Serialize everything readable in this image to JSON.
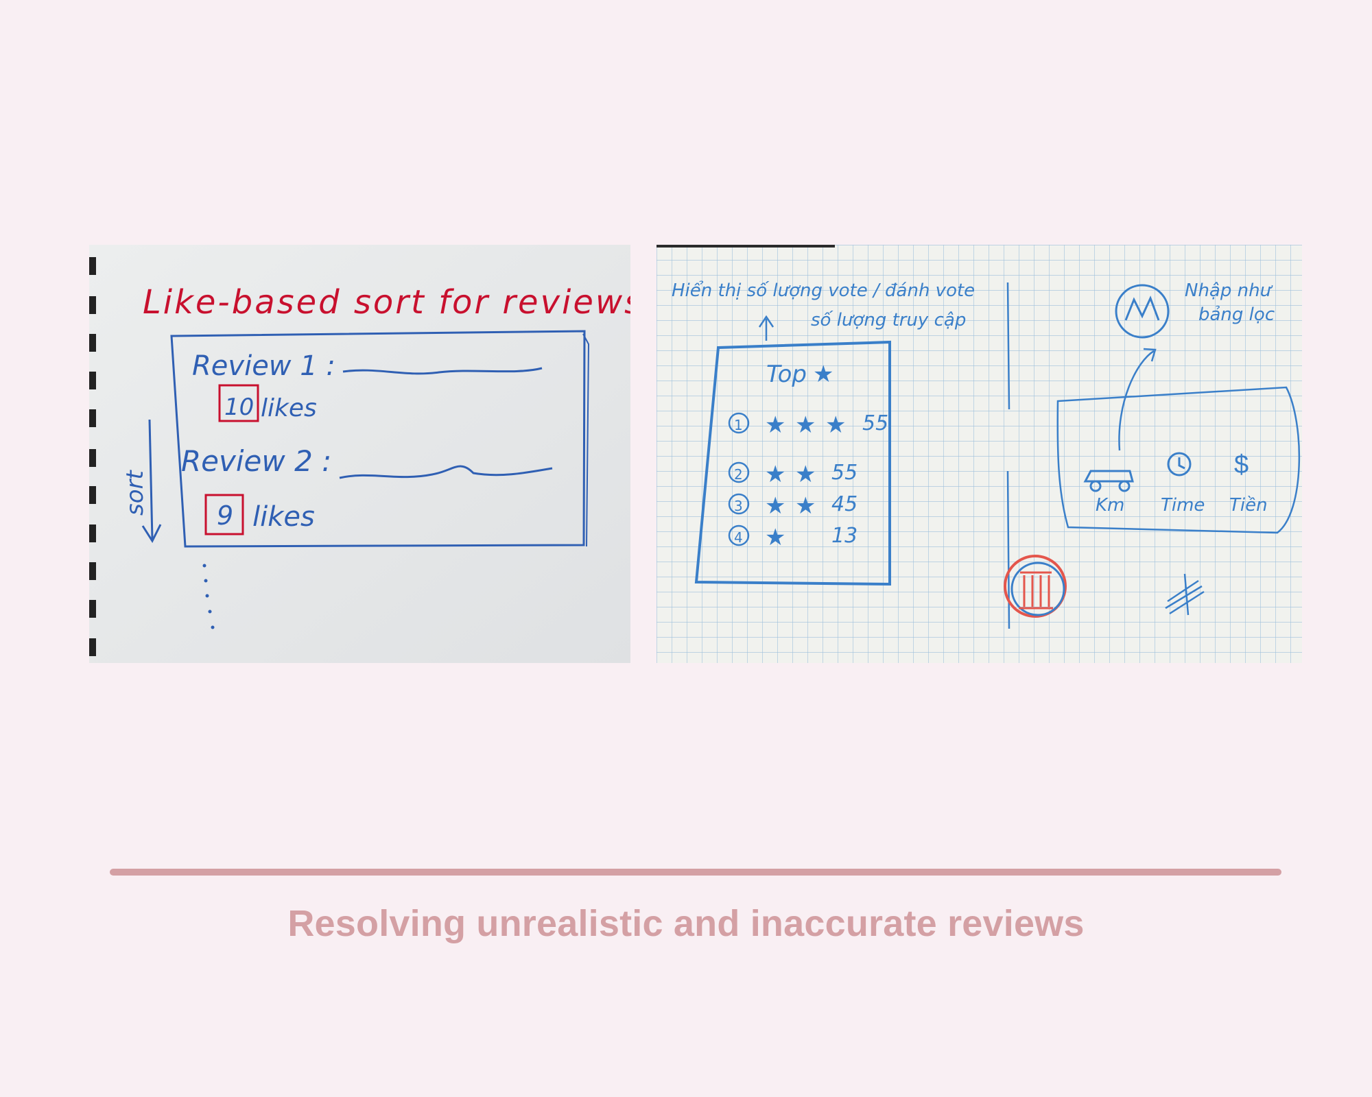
{
  "sketch_left": {
    "title": "Like-based sort for reviews",
    "reviews": [
      {
        "label": "Review 1 :",
        "likes_count": "10",
        "likes_word": "likes"
      },
      {
        "label": "Review 2 :",
        "likes_count": "9",
        "likes_word": "likes"
      }
    ],
    "sort_label": "sort"
  },
  "sketch_right": {
    "note_top": "Hiển thị số lượng vote / đánh vote",
    "note_top_2": "số lượng truy cập",
    "top_label": "Top",
    "ranking": [
      {
        "rank": "1",
        "stars": 3,
        "count": "55"
      },
      {
        "rank": "2",
        "stars": 2,
        "count": "55"
      },
      {
        "rank": "3",
        "stars": 2,
        "count": "45"
      },
      {
        "rank": "4",
        "stars": 1,
        "count": "13"
      }
    ],
    "note_right": "Nhập như",
    "note_right_2": "bảng lọc",
    "filters": [
      "Km",
      "Time",
      "Tiền"
    ]
  },
  "caption": "Resolving unrealistic and inaccurate reviews",
  "colors": {
    "background": "#f9eff3",
    "accent": "#d4a0a4",
    "ink_red": "#c8102e",
    "ink_blue": "#2f5fb3",
    "pencil_blue": "#3a7fc9"
  }
}
